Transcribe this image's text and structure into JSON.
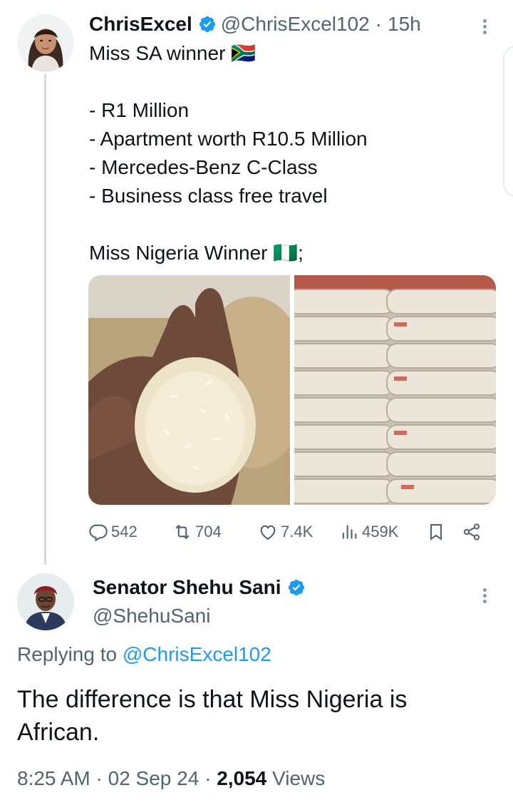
{
  "tweet": {
    "author_name": "ChrisExcel",
    "handle": "@ChrisExcel102",
    "separator": "·",
    "time": "15h",
    "line1": "Miss SA winner 🇿🇦",
    "list": [
      "- R1 Million",
      "- Apartment worth R10.5 Million",
      "- Mercedes-Benz C-Class",
      "- Business class free travel"
    ],
    "line3": "Miss Nigeria Winner 🇳🇬;",
    "media": [
      {
        "icon": "rice-grains-in-hand-photo"
      },
      {
        "icon": "stacked-rice-sacks-photo"
      }
    ],
    "stats": {
      "replies": "542",
      "retweets": "704",
      "likes": "7.4K",
      "views": "459K"
    }
  },
  "reply": {
    "author_name": "Senator Shehu Sani",
    "handle": "@ShehuSani",
    "replying_prefix": "Replying to",
    "replying_to": "@ChrisExcel102",
    "text": "The difference is that Miss Nigeria is African.",
    "time": "8:25 AM",
    "date": "02 Sep 24",
    "views_count": "2,054",
    "views_label": "Views"
  },
  "colors": {
    "accent": "#1d9bf0",
    "muted": "#536471",
    "text": "#0f1419",
    "thread_line": "#cfd9de"
  }
}
